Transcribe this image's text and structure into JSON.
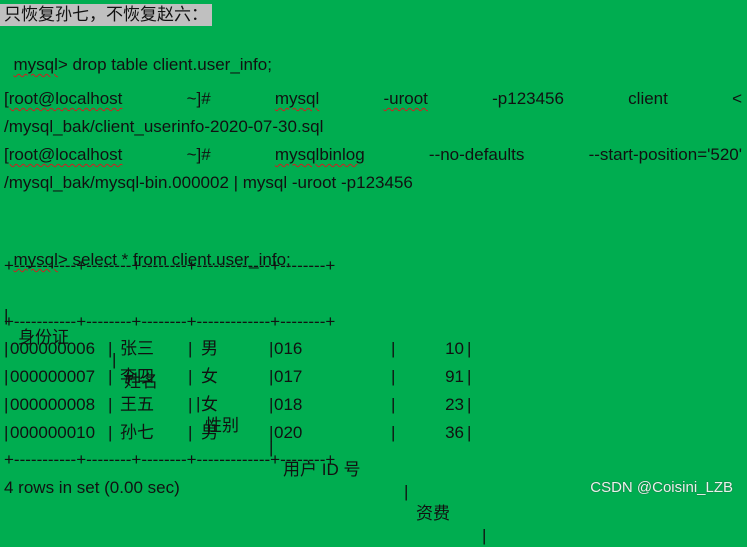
{
  "heading": "只恢复孙七，不恢复赵六：",
  "commands": {
    "drop": {
      "prompt": "mysql",
      "rest": "> drop table client.user_info;"
    },
    "restore_full": {
      "parts": [
        "[root@localhost",
        "~]#",
        "mysql",
        "-uroot",
        "-p123456",
        "client",
        "<"
      ],
      "continuation": "/mysql_bak/client_userinfo-2020-07-30.sql"
    },
    "restore_binlog": {
      "parts": [
        "[root@localhost",
        "~]#",
        "mysqlbinlog",
        "--no-defaults",
        "--start-position='520'"
      ],
      "continuation": "/mysql_bak/mysql-bin.000002 | mysql -uroot -p123456"
    },
    "select": {
      "prompt": "mysql",
      "rest": "> select * from client.user_info;"
    }
  },
  "table": {
    "border": "+-----------+--------+--------+-------------+--------+",
    "headers": [
      "身份证",
      "姓名",
      "性别",
      "用户 ID 号",
      "资费"
    ],
    "rows": [
      [
        "000000006",
        "张三",
        "男",
        "016",
        "10"
      ],
      [
        "000000007",
        "李四",
        "女",
        "017",
        "91"
      ],
      [
        "000000008",
        "王五",
        "女",
        "018",
        "23"
      ],
      [
        "000000010",
        "孙七",
        "男",
        "020",
        "36"
      ]
    ]
  },
  "result_summary": "4 rows in set (0.00 sec)",
  "watermark": "CSDN @Coisini_LZB"
}
